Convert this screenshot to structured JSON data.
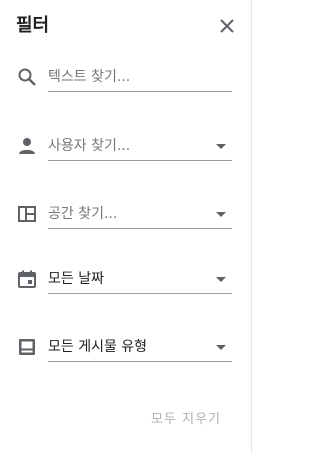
{
  "header": {
    "title": "필터",
    "close_icon": "close-icon"
  },
  "filters": {
    "search": {
      "icon": "search-icon",
      "placeholder": "텍스트 찾기..."
    },
    "user": {
      "icon": "person-icon",
      "placeholder": "사용자 찾기..."
    },
    "space": {
      "icon": "space-layout-icon",
      "placeholder": "공간 찾기..."
    },
    "date": {
      "icon": "calendar-icon",
      "value": "모든 날짜"
    },
    "post_type": {
      "icon": "post-type-icon",
      "value": "모든 게시물 유형"
    }
  },
  "footer": {
    "clear_all_label": "모두 지우기"
  },
  "colors": {
    "icon": "#5f6368",
    "underline": "#9e9e9e",
    "disabled_text": "#b0b0b0"
  }
}
